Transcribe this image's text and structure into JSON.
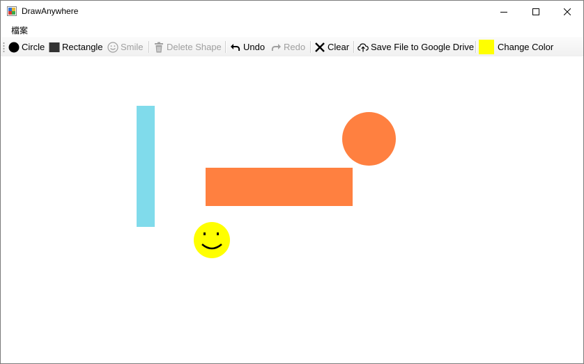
{
  "window": {
    "title": "DrawAnywhere",
    "app_icon": "app-icon",
    "controls": [
      "minimize-icon",
      "maximize-icon",
      "close-icon"
    ]
  },
  "menu": {
    "items": [
      {
        "label": "檔案"
      }
    ]
  },
  "toolbar": {
    "circle_label": "Circle",
    "rectangle_label": "Rectangle",
    "smile_label": "Smile",
    "delete_label": "Delete Shape",
    "undo_label": "Undo",
    "redo_label": "Redo",
    "clear_label": "Clear",
    "save_label": "Save File to Google Drive",
    "change_color_label": "Change Color",
    "current_color": "#ffff00"
  },
  "canvas": {
    "shapes": [
      {
        "type": "rectangle",
        "color": "#80dbeb"
      },
      {
        "type": "circle",
        "color": "#ff8040"
      },
      {
        "type": "rectangle",
        "color": "#ff8040"
      },
      {
        "type": "smile",
        "color": "#ffff00"
      }
    ]
  }
}
